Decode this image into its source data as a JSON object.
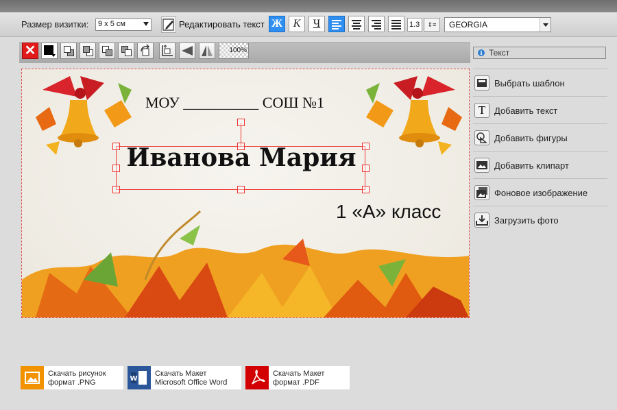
{
  "toolbar": {
    "size_label": "Размер визитки:",
    "size_value": "9 x 5 см",
    "edit_text_label": "Редактировать текст",
    "bold_label": "Ж",
    "italic_label": "К",
    "underline_label": "Ч",
    "line_height": "1.3",
    "font_name": "GEORGIA",
    "accent_color": "#2e8ff0"
  },
  "toolbar2": {
    "zoom_label": "100%",
    "delete_color": "#e31a1a",
    "delete_glyph": "✕",
    "text_color": "#000000"
  },
  "card": {
    "school_line": "МОУ __________ СОШ №1",
    "name": "Иванова Мария",
    "class_line": "1 «А» класс",
    "background": "#f1eee6"
  },
  "sidebar": {
    "panel_title": "Текст",
    "items": [
      {
        "label": "Выбрать шаблон",
        "icon": "template-icon"
      },
      {
        "label": "Добавить текст",
        "icon": "text-icon"
      },
      {
        "label": "Добавить фигуры",
        "icon": "shapes-icon"
      },
      {
        "label": "Добавить клипарт",
        "icon": "clipart-icon"
      },
      {
        "label": "Фоновое изображение",
        "icon": "background-image-icon"
      },
      {
        "label": "Загрузить фото",
        "icon": "upload-photo-icon"
      }
    ]
  },
  "downloads": [
    {
      "line1": "Скачать рисунок",
      "line2": "формат .PNG",
      "color": "#f39200",
      "icon": "png-image-icon"
    },
    {
      "line1": "Скачать Макет",
      "line2": "Microsoft Office Word",
      "color": "#2b579a",
      "icon": "word-icon"
    },
    {
      "line1": "Скачать Макет",
      "line2": "формат .PDF",
      "color": "#d20000",
      "icon": "pdf-icon"
    }
  ]
}
